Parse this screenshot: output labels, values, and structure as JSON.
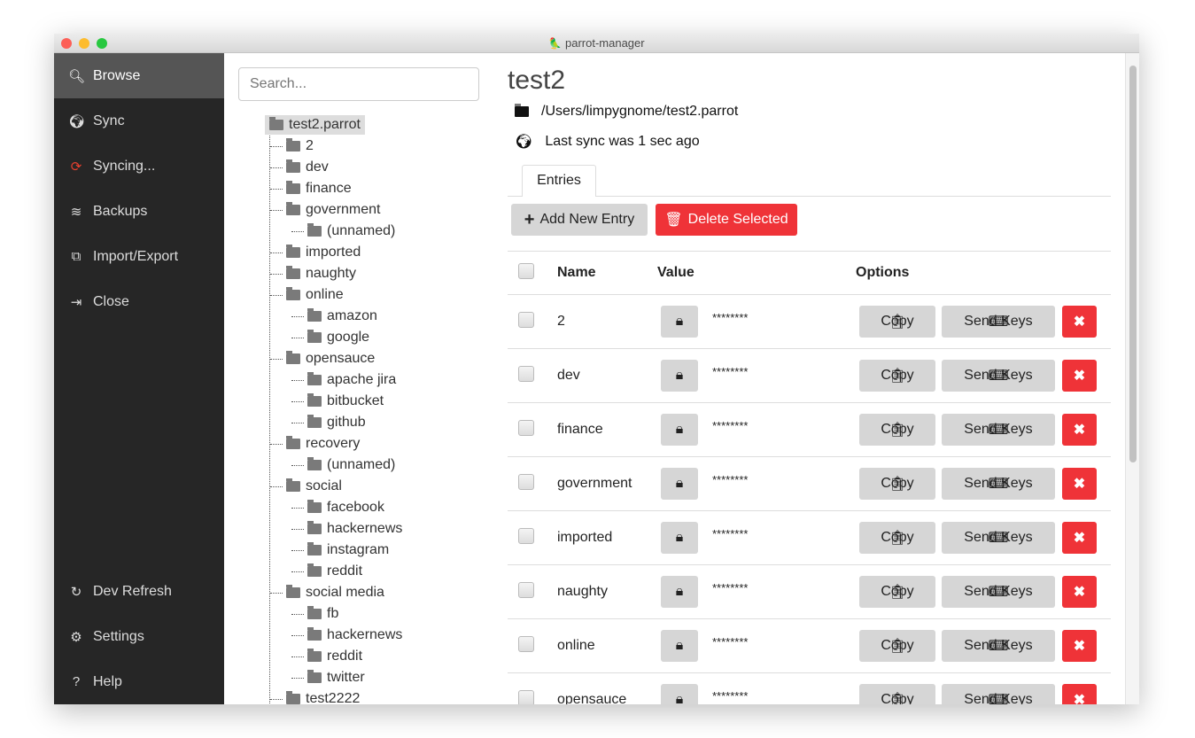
{
  "window": {
    "title": "parrot-manager"
  },
  "sidebar": {
    "items": [
      {
        "label": "Browse",
        "icon": "search-icon",
        "active": true
      },
      {
        "label": "Sync",
        "icon": "globe-icon"
      },
      {
        "label": "Syncing...",
        "icon": "sync-icon",
        "color": "#e8402e"
      },
      {
        "label": "Backups",
        "icon": "database-icon"
      },
      {
        "label": "Import/Export",
        "icon": "copy-icon"
      },
      {
        "label": "Close",
        "icon": "exit-icon"
      }
    ],
    "bottom": [
      {
        "label": "Dev Refresh",
        "icon": "refresh-icon"
      },
      {
        "label": "Settings",
        "icon": "gear-icon"
      },
      {
        "label": "Help",
        "icon": "help-icon"
      }
    ]
  },
  "tree": {
    "search_placeholder": "Search...",
    "nodes": [
      {
        "label": "test2.parrot",
        "depth": 0
      },
      {
        "label": "2",
        "depth": 1
      },
      {
        "label": "dev",
        "depth": 1
      },
      {
        "label": "finance",
        "depth": 1
      },
      {
        "label": "government",
        "depth": 1
      },
      {
        "label": "(unnamed)",
        "depth": 2
      },
      {
        "label": "imported",
        "depth": 1
      },
      {
        "label": "naughty",
        "depth": 1
      },
      {
        "label": "online",
        "depth": 1
      },
      {
        "label": "amazon",
        "depth": 2
      },
      {
        "label": "google",
        "depth": 2
      },
      {
        "label": "opensauce",
        "depth": 1
      },
      {
        "label": "apache jira",
        "depth": 2
      },
      {
        "label": "bitbucket",
        "depth": 2
      },
      {
        "label": "github",
        "depth": 2
      },
      {
        "label": "recovery",
        "depth": 1
      },
      {
        "label": "(unnamed)",
        "depth": 2
      },
      {
        "label": "social",
        "depth": 1
      },
      {
        "label": "facebook",
        "depth": 2
      },
      {
        "label": "hackernews",
        "depth": 2
      },
      {
        "label": "instagram",
        "depth": 2
      },
      {
        "label": "reddit",
        "depth": 2
      },
      {
        "label": "social media",
        "depth": 1
      },
      {
        "label": "fb",
        "depth": 2
      },
      {
        "label": "hackernews",
        "depth": 2
      },
      {
        "label": "reddit",
        "depth": 2
      },
      {
        "label": "twitter",
        "depth": 2
      },
      {
        "label": "test2222",
        "depth": 1
      }
    ]
  },
  "main": {
    "title": "test2",
    "path": "/Users/limpygnome/test2.parrot",
    "sync_status": "Last sync was 1 sec ago",
    "tab": "Entries",
    "add_label": "Add New Entry",
    "delete_label": "Delete Selected",
    "columns": {
      "name": "Name",
      "value": "Value",
      "options": "Options"
    },
    "copy_label": "Copy",
    "sendkeys_label": "Send Keys",
    "rows": [
      {
        "name": "2",
        "value": "********"
      },
      {
        "name": "dev",
        "value": "********"
      },
      {
        "name": "finance",
        "value": "********"
      },
      {
        "name": "government",
        "value": "********"
      },
      {
        "name": "imported",
        "value": "********"
      },
      {
        "name": "naughty",
        "value": "********"
      },
      {
        "name": "online",
        "value": "********"
      },
      {
        "name": "opensauce",
        "value": "********"
      }
    ]
  }
}
